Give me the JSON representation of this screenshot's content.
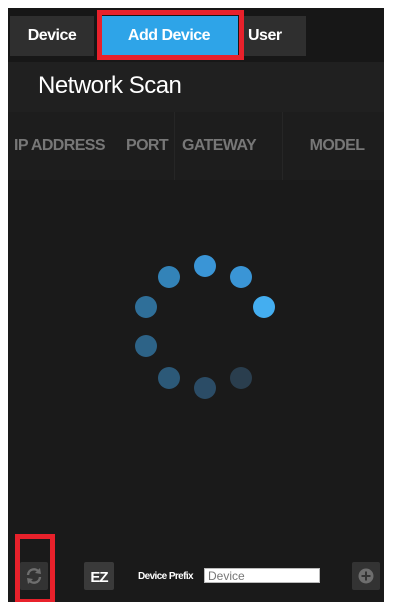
{
  "tabs": [
    {
      "label": "Device",
      "active": false
    },
    {
      "label": "Add Device",
      "active": true
    },
    {
      "label": "User",
      "active": false
    }
  ],
  "page_title": "Network Scan",
  "table": {
    "columns": [
      "IP ADDRESS",
      "PORT",
      "GATEWAY",
      "MODEL"
    ],
    "rows": []
  },
  "scan_status": "scanning",
  "toolbar": {
    "refresh_icon": "refresh-icon",
    "ez_label": "EZ",
    "device_prefix_label": "Device Prefix",
    "device_prefix_value": "Device",
    "add_icon": "plus-circle-icon"
  },
  "colors": {
    "accent": "#2ea4e8",
    "highlight": "#e8212b",
    "background": "#1a1a1a",
    "tab_inactive": "#2f2f2f"
  }
}
